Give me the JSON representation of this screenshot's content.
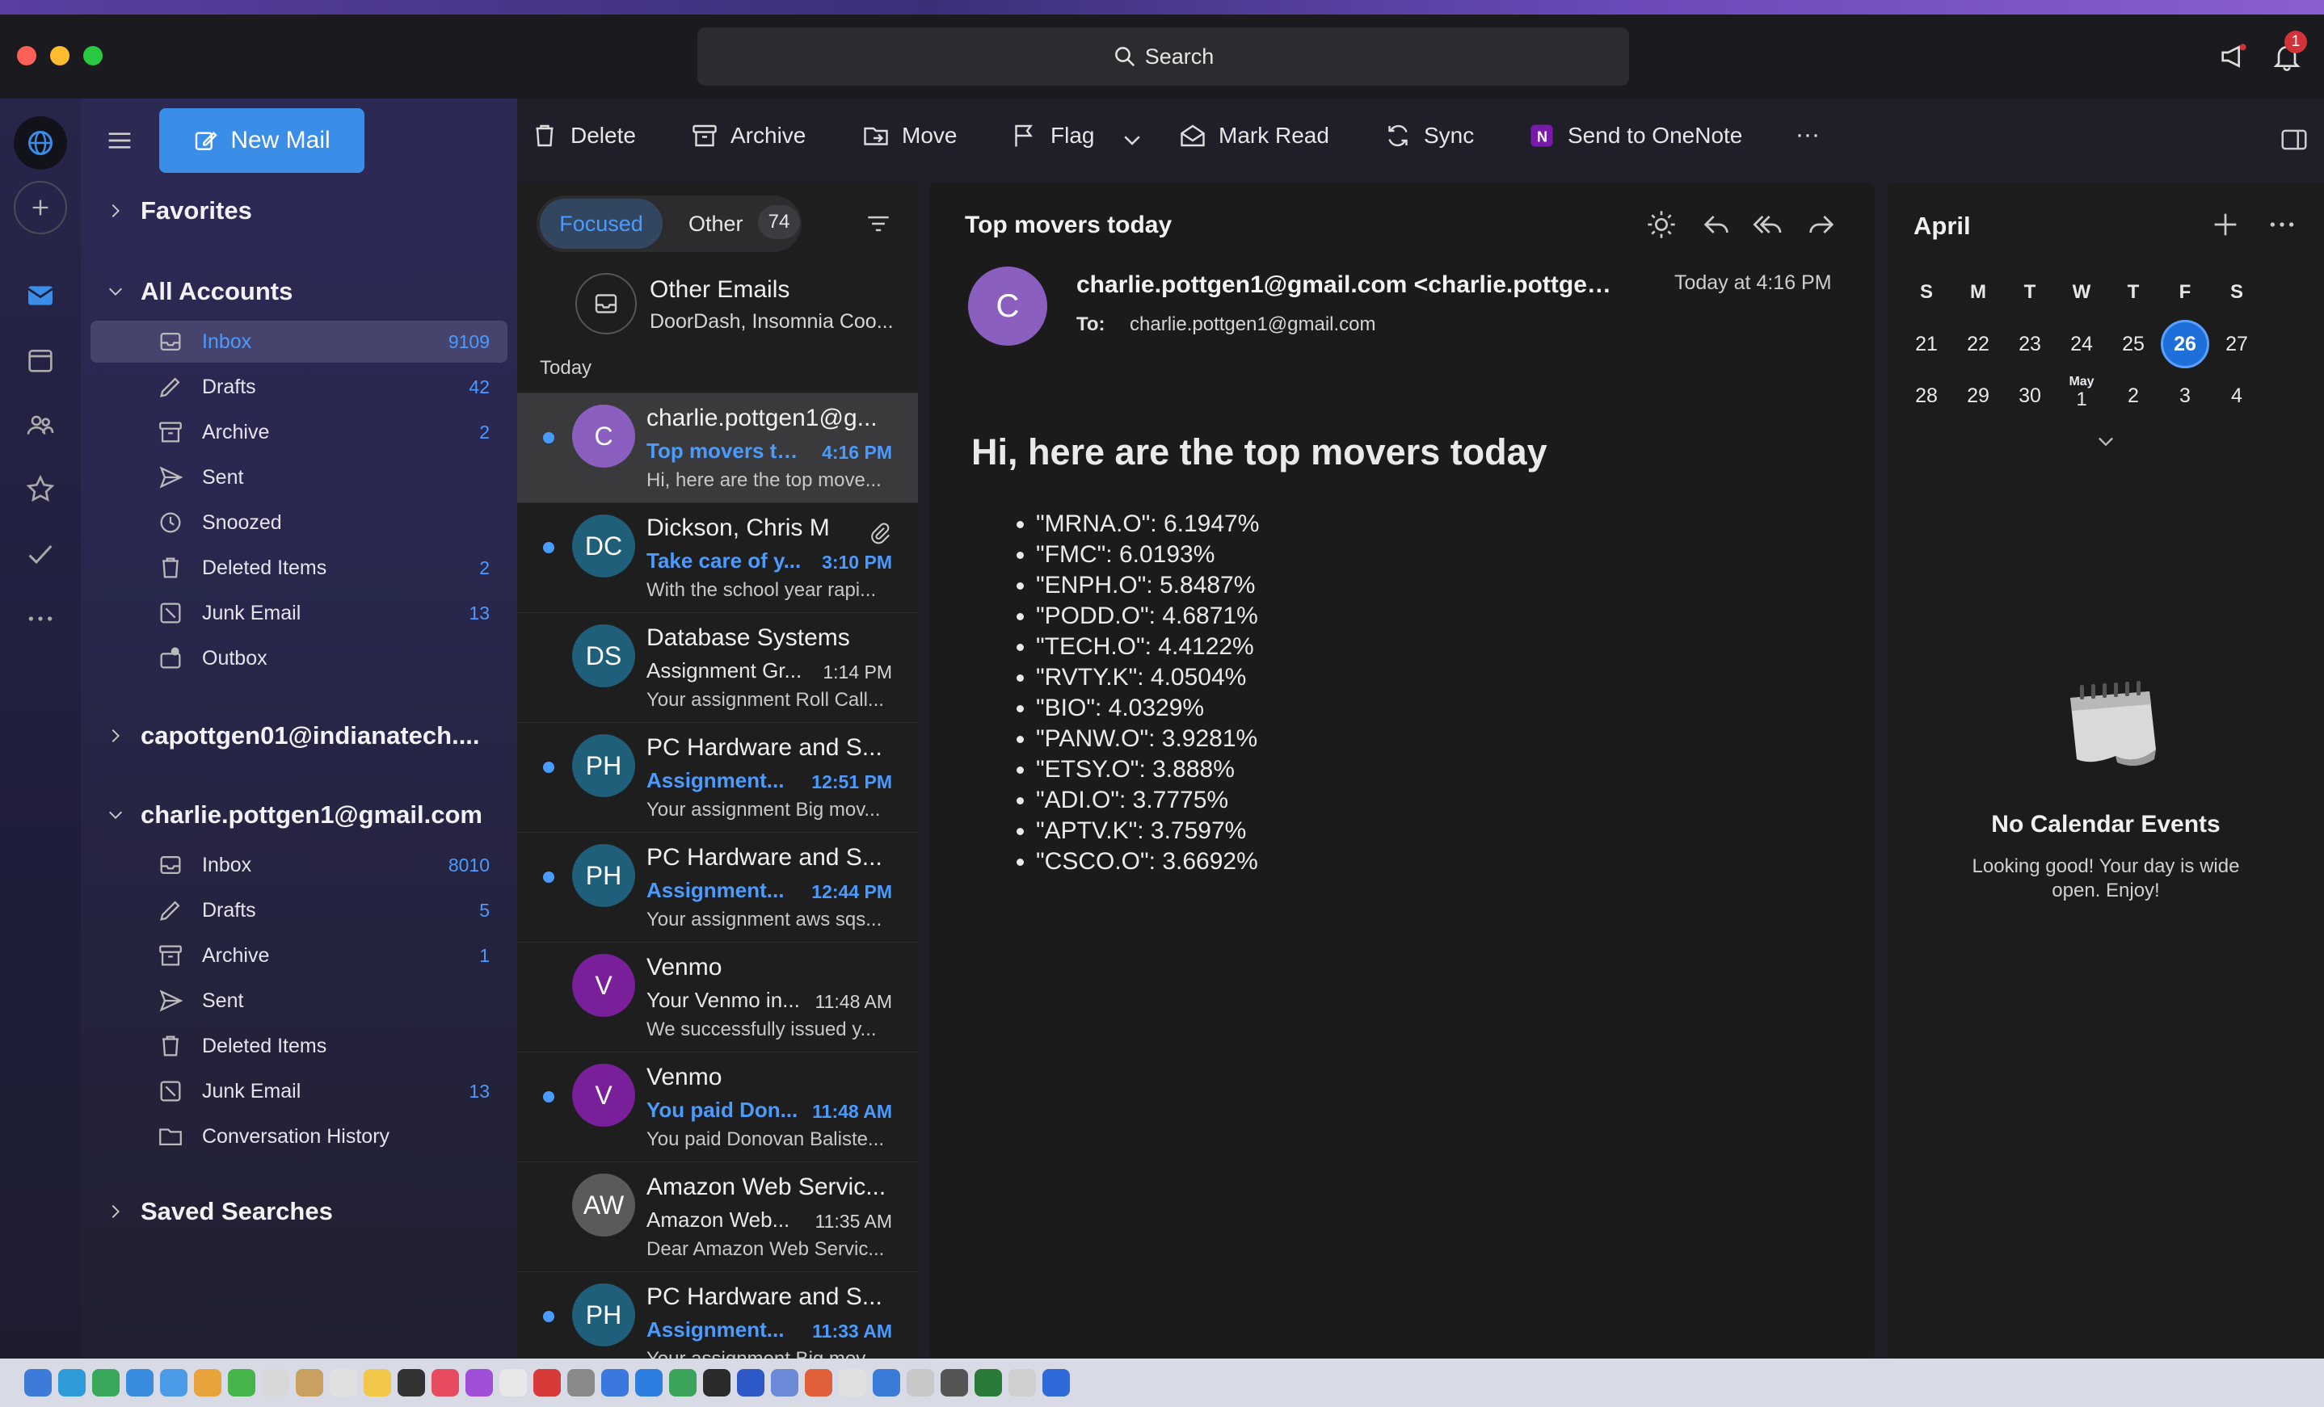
{
  "titlebar": {
    "search_label": "Search",
    "notification_count": "1"
  },
  "toolbar": {
    "new_mail": "New Mail",
    "delete": "Delete",
    "archive": "Archive",
    "move": "Move",
    "flag": "Flag",
    "mark_read": "Mark Read",
    "sync": "Sync",
    "onenote": "Send to OneNote",
    "more": "···"
  },
  "nav": {
    "favorites": "Favorites",
    "all_accounts": "All Accounts",
    "all_accounts_folders": [
      {
        "label": "Inbox",
        "count": "9109",
        "icon": "inbox-icon"
      },
      {
        "label": "Drafts",
        "count": "42",
        "icon": "pencil-icon"
      },
      {
        "label": "Archive",
        "count": "2",
        "icon": "archive-icon"
      },
      {
        "label": "Sent",
        "count": "",
        "icon": "send-icon"
      },
      {
        "label": "Snoozed",
        "count": "",
        "icon": "clock-icon"
      },
      {
        "label": "Deleted Items",
        "count": "2",
        "icon": "trash-icon"
      },
      {
        "label": "Junk Email",
        "count": "13",
        "icon": "junk-icon"
      },
      {
        "label": "Outbox",
        "count": "",
        "icon": "outbox-icon"
      }
    ],
    "account1": "capottgen01@indianatech....",
    "account2": "charlie.pottgen1@gmail.com",
    "account2_folders": [
      {
        "label": "Inbox",
        "count": "8010",
        "icon": "inbox-icon"
      },
      {
        "label": "Drafts",
        "count": "5",
        "icon": "pencil-icon"
      },
      {
        "label": "Archive",
        "count": "1",
        "icon": "archive-icon"
      },
      {
        "label": "Sent",
        "count": "",
        "icon": "send-icon"
      },
      {
        "label": "Deleted Items",
        "count": "",
        "icon": "trash-icon"
      },
      {
        "label": "Junk Email",
        "count": "13",
        "icon": "junk-icon"
      },
      {
        "label": "Conversation History",
        "count": "",
        "icon": "folder-icon"
      }
    ],
    "saved_searches": "Saved Searches"
  },
  "list": {
    "focused": "Focused",
    "other": "Other",
    "other_count": "74",
    "other_emails_title": "Other Emails",
    "other_emails_preview": "DoorDash, Insomnia Coo...",
    "today": "Today",
    "messages": [
      {
        "initials": "C",
        "color": "#8b5fbf",
        "sender": "charlie.pottgen1@g...",
        "subject": "Top movers to...",
        "time": "4:16 PM",
        "preview": "Hi, here are the top move...",
        "unread": true,
        "selected": true
      },
      {
        "initials": "DC",
        "color": "#1f5f7a",
        "sender": "Dickson, Chris M",
        "subject": "Take care of y...",
        "time": "3:10 PM",
        "preview": "With the school year rapi...",
        "unread": true,
        "attachment": true
      },
      {
        "initials": "DS",
        "color": "#1f5f7a",
        "sender": "Database Systems",
        "subject": "Assignment Gr...",
        "time": "1:14 PM",
        "preview": "Your assignment Roll Call...",
        "unread": false
      },
      {
        "initials": "PH",
        "color": "#1f5f7a",
        "sender": "PC Hardware and S...",
        "subject": "Assignment...",
        "time": "12:51 PM",
        "preview": "Your assignment Big mov...",
        "unread": true
      },
      {
        "initials": "PH",
        "color": "#1f5f7a",
        "sender": "PC Hardware and S...",
        "subject": "Assignment...",
        "time": "12:44 PM",
        "preview": "Your assignment aws sqs...",
        "unread": true
      },
      {
        "initials": "V",
        "color": "#7a1f9a",
        "sender": "Venmo",
        "subject": "Your Venmo in...",
        "time": "11:48 AM",
        "preview": "We successfully issued y...",
        "unread": false
      },
      {
        "initials": "V",
        "color": "#7a1f9a",
        "sender": "Venmo",
        "subject": "You paid Don...",
        "time": "11:48 AM",
        "preview": "You paid Donovan Baliste...",
        "unread": true
      },
      {
        "initials": "AW",
        "color": "#5a5a5a",
        "sender": "Amazon Web Servic...",
        "subject": "Amazon Web...",
        "time": "11:35 AM",
        "preview": "Dear Amazon Web Servic...",
        "unread": false
      },
      {
        "initials": "PH",
        "color": "#1f5f7a",
        "sender": "PC Hardware and S...",
        "subject": "Assignment...",
        "time": "11:33 AM",
        "preview": "Your assignment Big mov...",
        "unread": true
      }
    ]
  },
  "reading": {
    "subject": "Top movers today",
    "avatar": "C",
    "from": "charlie.pottgen1@gmail.com <charlie.pottgen1...",
    "date": "Today at 4:16 PM",
    "to_label": "To:",
    "to": "charlie.pottgen1@gmail.com",
    "heading": "Hi, here are the top movers today",
    "items": [
      "\"MRNA.O\": 6.1947%",
      "\"FMC\": 6.0193%",
      "\"ENPH.O\": 5.8487%",
      "\"PODD.O\": 4.6871%",
      "\"TECH.O\": 4.4122%",
      "\"RVTY.K\": 4.0504%",
      "\"BIO\": 4.0329%",
      "\"PANW.O\": 3.9281%",
      "\"ETSY.O\": 3.888%",
      "\"ADI.O\": 3.7775%",
      "\"APTV.K\": 3.7597%",
      "\"CSCO.O\": 3.6692%"
    ]
  },
  "calendar": {
    "month": "April",
    "dow": [
      "S",
      "M",
      "T",
      "W",
      "T",
      "F",
      "S"
    ],
    "week1": [
      "21",
      "22",
      "23",
      "24",
      "25",
      "26",
      "27"
    ],
    "week2": [
      "28",
      "29",
      "30",
      "1",
      "2",
      "3",
      "4"
    ],
    "may_label": "May",
    "today": "26",
    "no_events": "No Calendar Events",
    "no_events_sub": "Looking good! Your day is wide open. Enjoy!"
  },
  "colors": {
    "accent": "#3b8ee8",
    "unread_blue": "#4a9bff"
  }
}
